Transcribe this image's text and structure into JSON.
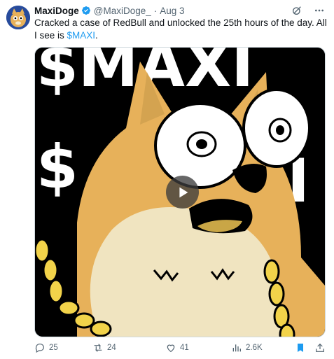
{
  "tweet": {
    "author_name": "MaxiDoge",
    "handle": "@MaxiDoge_",
    "separator": "·",
    "date": "Aug 3",
    "text_before": "Cracked a case of RedBull and unlocked the 25th hours of the day. All I see is ",
    "cashtag": "$MAXI",
    "text_after": ".",
    "media_overlay_text": [
      "$MAXI",
      "$",
      "I"
    ]
  },
  "actions": {
    "replies": "25",
    "reposts": "24",
    "likes": "41",
    "views": "2.6K"
  },
  "icons": [
    "verified-icon",
    "grok-icon",
    "more-icon",
    "play-icon",
    "reply-icon",
    "repost-icon",
    "like-icon",
    "views-icon",
    "bookmark-icon",
    "share-icon"
  ],
  "colors": {
    "accent": "#1d9bf0",
    "muted": "#536471",
    "doge_fur": "#e7b15a",
    "chain_gold": "#f2d34a"
  }
}
